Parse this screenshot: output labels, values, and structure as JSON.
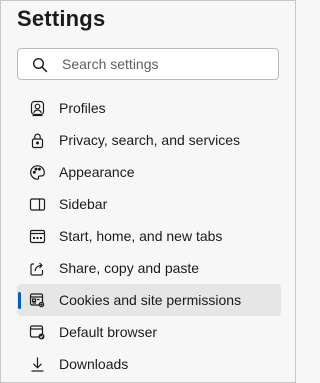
{
  "page": {
    "title": "Settings"
  },
  "search": {
    "placeholder": "Search settings",
    "value": ""
  },
  "accent": "#005fb8",
  "nav": {
    "items": [
      {
        "label": "Profiles",
        "icon": "profile-icon"
      },
      {
        "label": "Privacy, search, and services",
        "icon": "lock-icon"
      },
      {
        "label": "Appearance",
        "icon": "palette-icon"
      },
      {
        "label": "Sidebar",
        "icon": "sidebar-icon"
      },
      {
        "label": "Start, home, and new tabs",
        "icon": "home-tabs-icon"
      },
      {
        "label": "Share, copy and paste",
        "icon": "share-icon"
      },
      {
        "label": "Cookies and site permissions",
        "icon": "cookies-icon",
        "selected": true
      },
      {
        "label": "Default browser",
        "icon": "default-browser-icon"
      },
      {
        "label": "Downloads",
        "icon": "download-icon"
      }
    ]
  }
}
